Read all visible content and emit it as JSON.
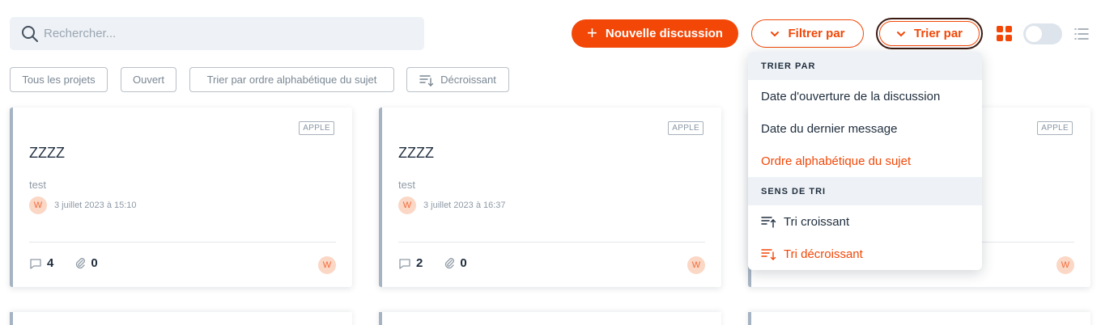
{
  "search": {
    "placeholder": "Rechercher..."
  },
  "toolbar": {
    "new_discussion_label": "Nouvelle discussion",
    "filter_label": "Filtrer par",
    "sort_label": "Trier par",
    "view_grid_active": true
  },
  "chips": [
    {
      "label": "Tous les projets"
    },
    {
      "label": "Ouvert"
    },
    {
      "label": "Trier par ordre alphabétique du sujet"
    },
    {
      "label": "Décroissant"
    }
  ],
  "cards": [
    {
      "tag": "APPLE",
      "title": "ZZZZ",
      "description": "test",
      "author_initial": "W",
      "date": "3 juillet 2023 à 15:10",
      "comments": "4",
      "attachments": "0"
    },
    {
      "tag": "APPLE",
      "title": "ZZZZ",
      "description": "test",
      "author_initial": "W",
      "date": "3 juillet 2023 à 16:37",
      "comments": "2",
      "attachments": "0"
    },
    {
      "tag": "APPLE",
      "author_initial": "W"
    }
  ],
  "sort_menu": {
    "section_order": "TRIER PAR",
    "options": [
      {
        "label": "Date d'ouverture de la discussion",
        "active": false
      },
      {
        "label": "Date du dernier message",
        "active": false
      },
      {
        "label": "Ordre alphabétique du sujet",
        "active": true
      }
    ],
    "section_direction": "SENS DE TRI",
    "directions": [
      {
        "label": "Tri croissant",
        "active": false
      },
      {
        "label": "Tri décroissant",
        "active": true
      }
    ]
  },
  "colors": {
    "accent": "#f24707",
    "card_border": "#a6b3c2",
    "section_bg": "#eef2f6"
  }
}
